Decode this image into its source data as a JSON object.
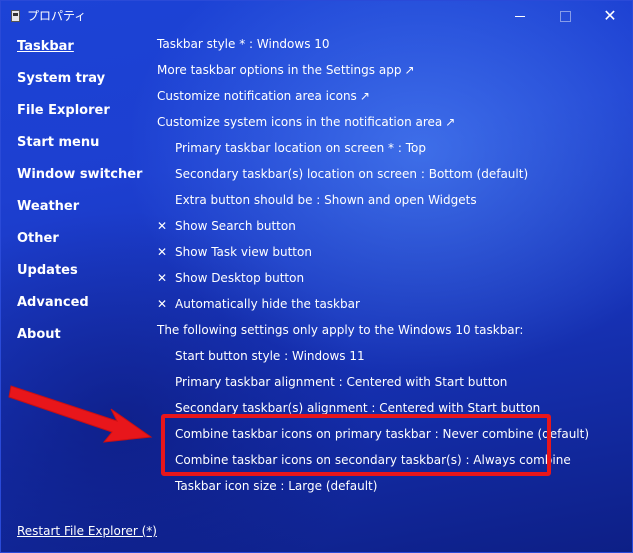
{
  "window": {
    "title": "プロパティ"
  },
  "sidebar": {
    "items": [
      {
        "label": "Taskbar",
        "active": true
      },
      {
        "label": "System tray"
      },
      {
        "label": "File Explorer"
      },
      {
        "label": "Start menu"
      },
      {
        "label": "Window switcher"
      },
      {
        "label": "Weather"
      },
      {
        "label": "Other"
      },
      {
        "label": "Updates"
      },
      {
        "label": "Advanced"
      },
      {
        "label": "About"
      }
    ],
    "restart_label": "Restart File Explorer (*)"
  },
  "settings": {
    "taskbar_style": "Taskbar style * : Windows 10",
    "more_options": "More taskbar options in the Settings app",
    "customize_notification": "Customize notification area icons",
    "customize_system_icons": "Customize system icons in the notification area",
    "primary_location": "Primary taskbar location on screen * : Top",
    "secondary_location": "Secondary taskbar(s) location on screen : Bottom (default)",
    "extra_button": "Extra button should be : Shown and open Widgets",
    "show_search": "Show Search button",
    "show_task_view": "Show Task view button",
    "show_desktop": "Show Desktop button",
    "auto_hide": "Automatically hide the taskbar",
    "win10_note": "The following settings only apply to the Windows 10 taskbar:",
    "start_button_style": "Start button style : Windows 11",
    "primary_alignment": "Primary taskbar alignment : Centered with Start button",
    "secondary_alignment": "Secondary taskbar(s) alignment : Centered with Start button",
    "combine_primary": "Combine taskbar icons on primary taskbar : Never combine (default)",
    "combine_secondary": "Combine taskbar icons on secondary taskbar(s) : Always combine",
    "icon_size": "Taskbar icon size : Large (default)"
  },
  "glyphs": {
    "external_link": "↗",
    "unchecked": "✕"
  },
  "colors": {
    "annotation_red": "#e8161b",
    "text": "#ffffff"
  }
}
